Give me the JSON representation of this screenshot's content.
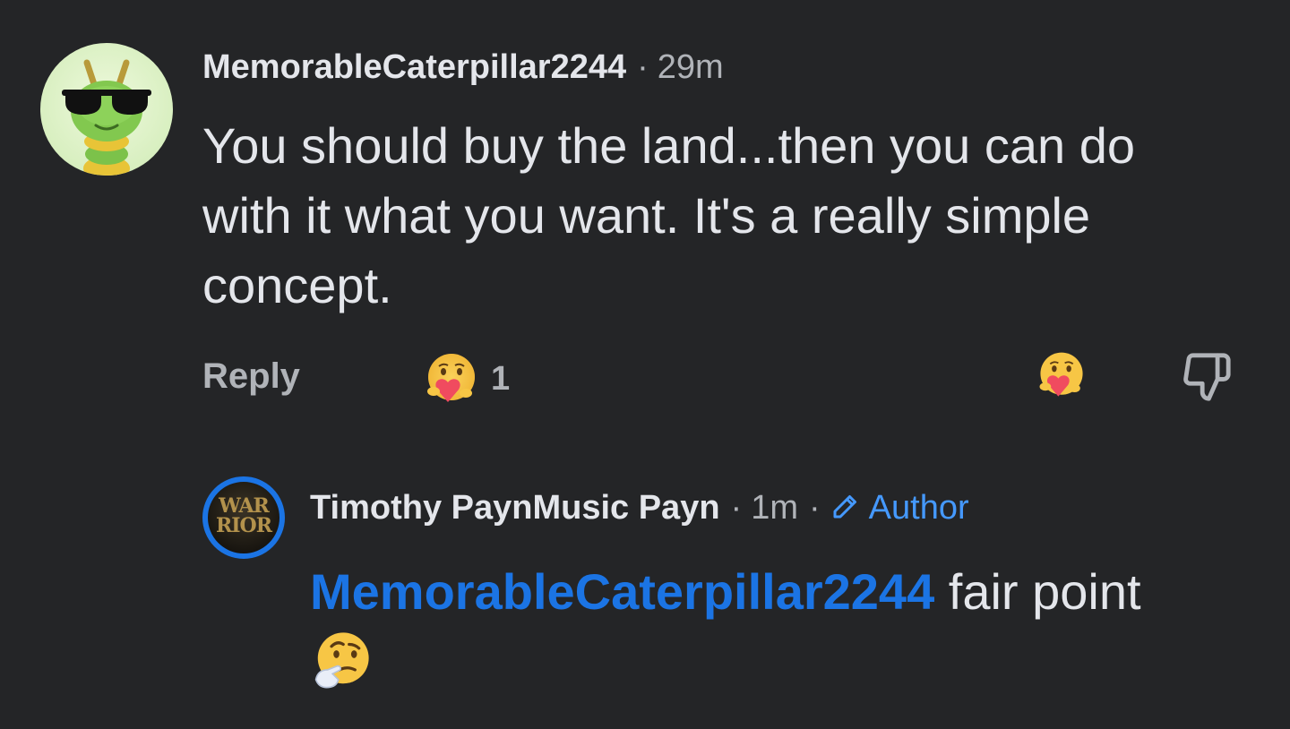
{
  "comment": {
    "author": "MemorableCaterpillar2244",
    "separator": "·",
    "time": "29m",
    "text": "You should buy the land...then you can do with it what you want. It's a really simple concept.",
    "reply_label": "Reply",
    "reaction_icon": "care-emoji",
    "reaction_count": "1",
    "react_button_icon": "care-emoji",
    "dislike_icon": "thumbs-down-icon"
  },
  "reply": {
    "author": "Timothy PaynMusic Payn",
    "separator": "·",
    "time": "1m",
    "author_badge_icon": "pen-icon",
    "author_badge": "Author",
    "avatar_text": "WAR RIOR",
    "mention": "MemorableCaterpillar2244",
    "text": "fair point",
    "emoji_icon": "thinking-face-emoji"
  },
  "colors": {
    "background": "#242527",
    "primary_text": "#e4e6eb",
    "secondary_text": "#b0b3b8",
    "mention_blue": "#1b74e4",
    "author_badge_blue": "#4599ff"
  }
}
